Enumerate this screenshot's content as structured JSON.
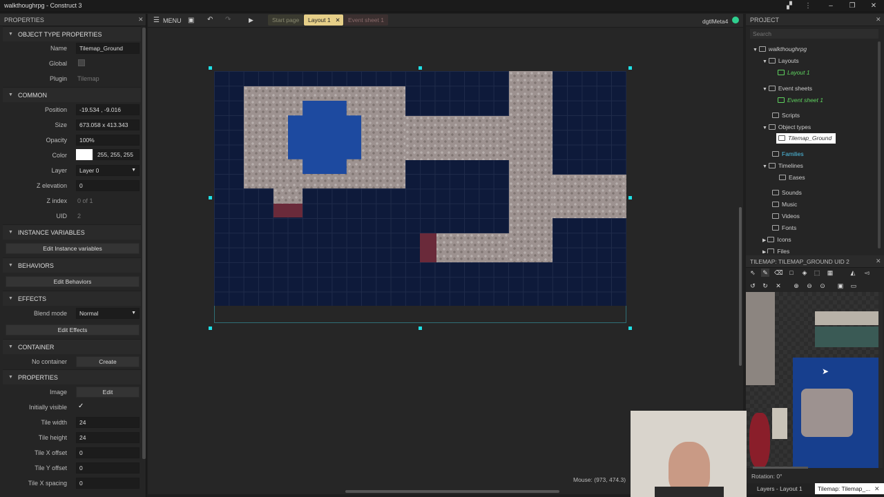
{
  "window": {
    "title": "walkthoughrpg - Construct 3"
  },
  "left_panel": {
    "title": "PROPERTIES",
    "object_type_section": "OBJECT TYPE PROPERTIES",
    "name_label": "Name",
    "name_value": "Tilemap_Ground",
    "global_label": "Global",
    "plugin_label": "Plugin",
    "plugin_value": "Tilemap",
    "common_section": "COMMON",
    "position_label": "Position",
    "position_value": "-19.534 , -9.016",
    "size_label": "Size",
    "size_value": "673.058 x 413.343",
    "opacity_label": "Opacity",
    "opacity_value": "100%",
    "color_label": "Color",
    "color_value": "255, 255, 255",
    "layer_label": "Layer",
    "layer_value": "Layer 0",
    "zelev_label": "Z elevation",
    "zelev_value": "0",
    "zindex_label": "Z index",
    "zindex_value": "0 of 1",
    "uid_label": "UID",
    "uid_value": "2",
    "instvars_section": "INSTANCE VARIABLES",
    "edit_instvars": "Edit Instance variables",
    "behaviors_section": "BEHAVIORS",
    "edit_behaviors": "Edit Behaviors",
    "effects_section": "EFFECTS",
    "blend_label": "Blend mode",
    "blend_value": "Normal",
    "edit_effects": "Edit Effects",
    "container_section": "CONTAINER",
    "no_container": "No container",
    "create": "Create",
    "properties_section": "PROPERTIES",
    "image_label": "Image",
    "image_edit": "Edit",
    "visible_label": "Initially visible",
    "tilew_label": "Tile width",
    "tilew_value": "24",
    "tileh_label": "Tile height",
    "tileh_value": "24",
    "tilexo_label": "Tile X offset",
    "tilexo_value": "0",
    "tileyo_label": "Tile Y offset",
    "tileyo_value": "0",
    "tilexs_label": "Tile X spacing",
    "tilexs_value": "0"
  },
  "toolbar": {
    "menu": "MENU",
    "tabs": [
      "Start page",
      "Layout 1",
      "Event sheet 1"
    ],
    "user": "dgtlMeta4"
  },
  "status": {
    "mouse": "Mouse: (973, 474.3)"
  },
  "project": {
    "title": "PROJECT",
    "search_placeholder": "Search",
    "root": "walkthoughrpg",
    "layouts": "Layouts",
    "layout1": "Layout 1",
    "event_sheets": "Event sheets",
    "event_sheet1": "Event sheet 1",
    "scripts": "Scripts",
    "object_types": "Object types",
    "tilemap_ground": "Tilemap_Ground",
    "families": "Families",
    "timelines": "Timelines",
    "eases": "Eases",
    "sounds": "Sounds",
    "music": "Music",
    "videos": "Videos",
    "fonts": "Fonts",
    "icons": "Icons",
    "files": "Files"
  },
  "tilemap_panel": {
    "title": "TILEMAP: TILEMAP_GROUND UID 2",
    "rotation": "Rotation: 0°"
  },
  "bottom_tabs": {
    "layers": "Layers - Layout 1",
    "tilemap": "Tilemap: Tilemap_..."
  },
  "colors": {
    "accent_cyan": "#1fe0e6",
    "green": "#5fd35f",
    "water": "#1d4aa0"
  }
}
